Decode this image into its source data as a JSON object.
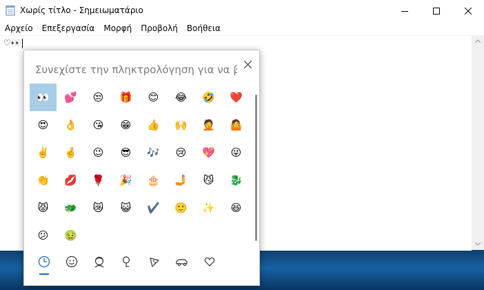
{
  "window": {
    "title": "Χωρίς τίτλο - Σημειωματάριο"
  },
  "menu": [
    "Αρχείο",
    "Επεξεργασία",
    "Μορφή",
    "Προβολή",
    "Βοήθεια"
  ],
  "editor": {
    "content": "♡👀"
  },
  "emoji_panel": {
    "search_placeholder": "Συνεχίστε την πληκτρολόγηση για να βρείτε",
    "categories": [
      "recent-icon",
      "smiley-icon",
      "people-icon",
      "location-icon",
      "food-icon",
      "vehicle-icon",
      "heart-icon"
    ],
    "selected_category": 0,
    "emojis": [
      "👀",
      "💕",
      "😒",
      "🎁",
      "😊",
      "😂",
      "🤣",
      "❤️",
      "😍",
      "👌",
      "😘",
      "😁",
      "👍",
      "🙌",
      "🤦",
      "🤷",
      "✌️",
      "🤞",
      "😉",
      "😎",
      "🎶",
      "😢",
      "💖",
      "😜",
      "👏",
      "💋",
      "🌹",
      "🎉",
      "🎂",
      "🤳",
      "😼",
      "🐉",
      "😾",
      "🐲",
      "😿",
      "😺",
      "✔️",
      "🙂",
      "✨",
      "😆",
      "😕",
      "🤢"
    ],
    "selected_emoji": 0
  },
  "colors": {
    "accent": "#1c6cb8",
    "selection": "#a8cde6"
  }
}
